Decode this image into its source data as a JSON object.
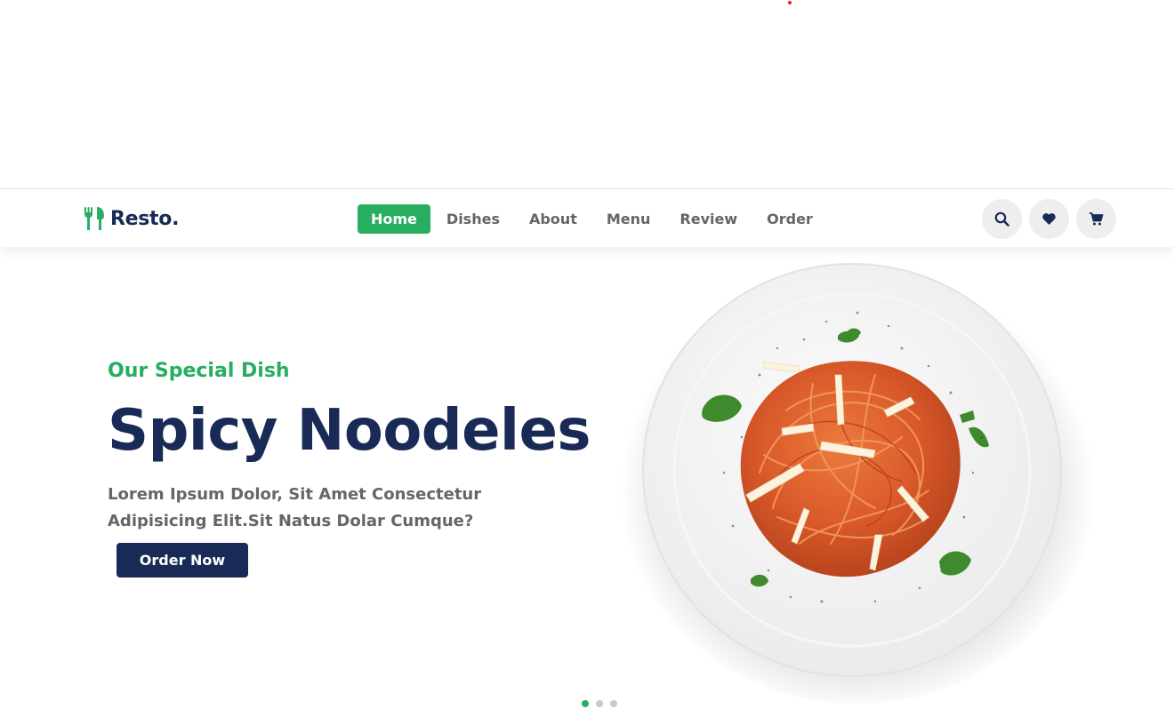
{
  "brand": {
    "name": "Resto."
  },
  "nav": {
    "items": [
      {
        "label": "Home",
        "active": true
      },
      {
        "label": "Dishes",
        "active": false
      },
      {
        "label": "About",
        "active": false
      },
      {
        "label": "Menu",
        "active": false
      },
      {
        "label": "Review",
        "active": false
      },
      {
        "label": "Order",
        "active": false
      }
    ]
  },
  "header_icons": [
    "search-icon",
    "heart-icon",
    "cart-icon"
  ],
  "hero": {
    "subtitle": "Our Special Dish",
    "title": "Spicy Noodeles",
    "description": "Lorem Ipsum Dolor, Sit Amet Consectetur Adipisicing Elit.Sit Natus Dolar Cumque?",
    "button_label": "Order Now",
    "slides_total": 3,
    "slide_active": 1
  },
  "colors": {
    "accent": "#27ae60",
    "navy": "#192a56",
    "text_gray": "#666666",
    "icon_bg": "#eeeeee"
  }
}
